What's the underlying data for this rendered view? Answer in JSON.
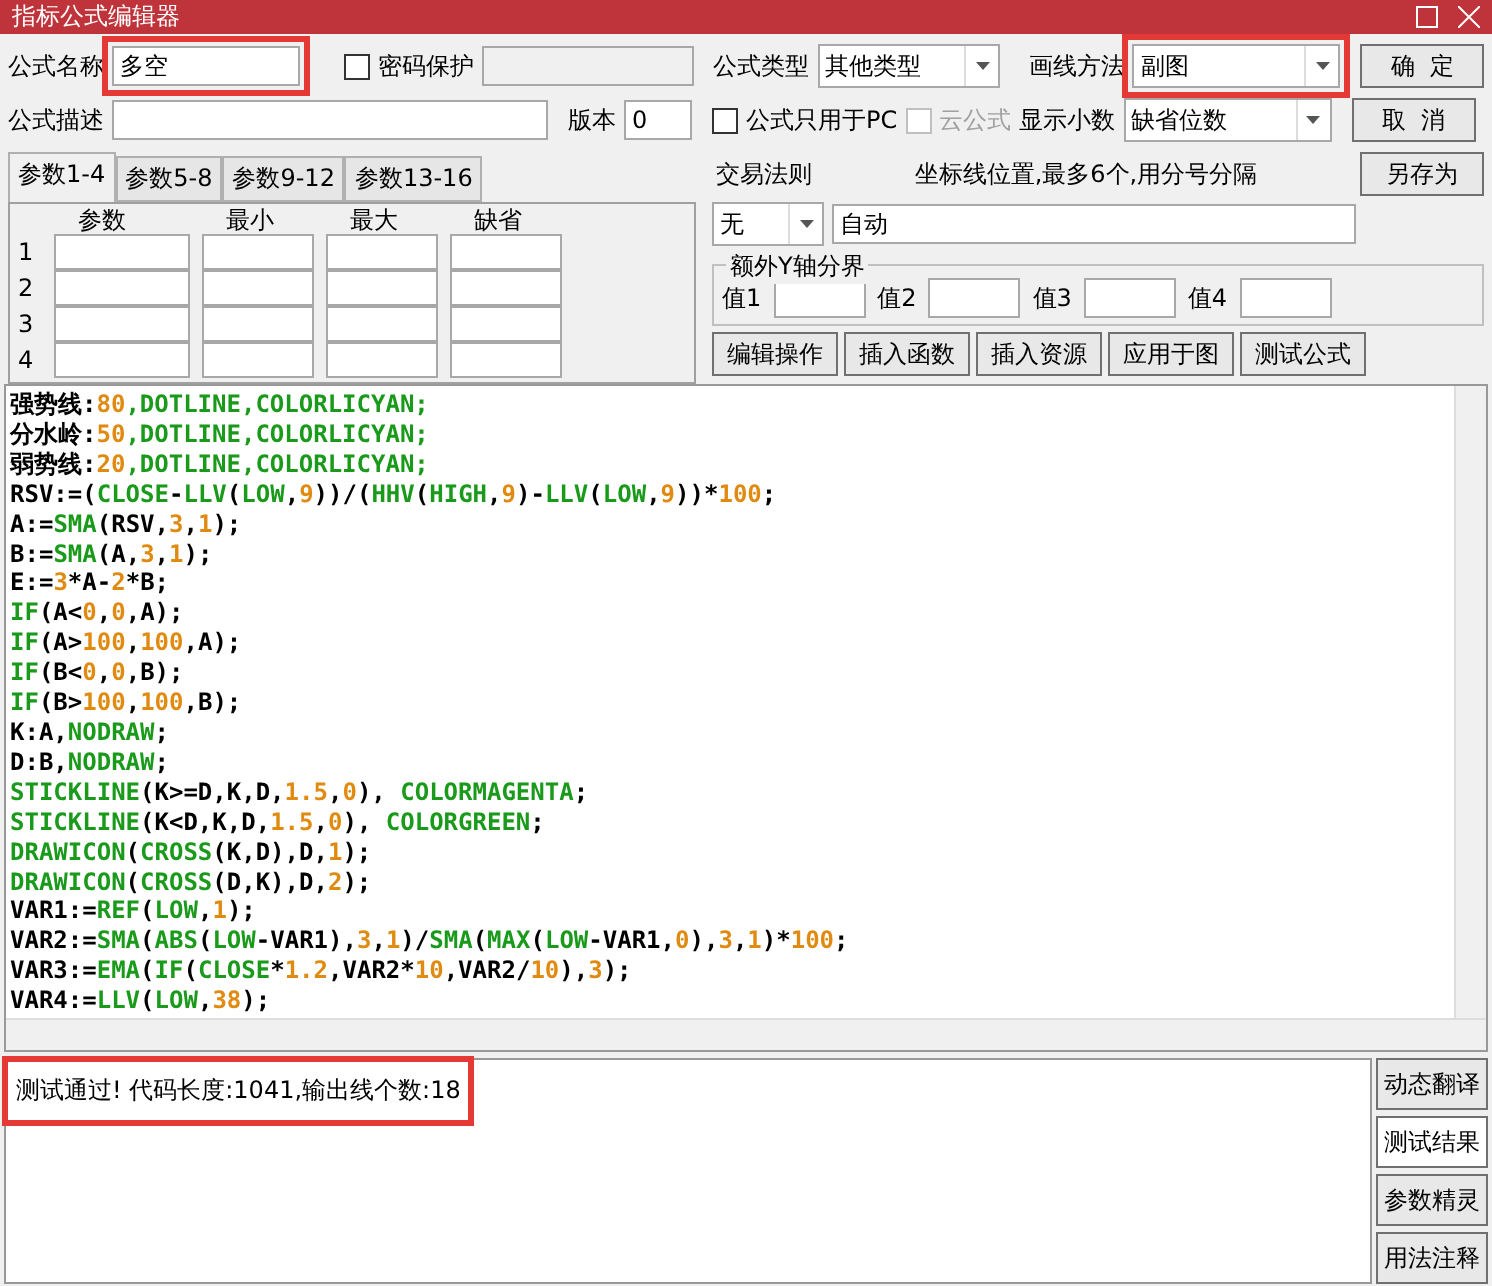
{
  "window": {
    "title": "指标公式编辑器"
  },
  "header": {
    "name_label": "公式名称",
    "name_value": "多空",
    "password": {
      "label": "密码保护",
      "checked": false
    },
    "type_label": "公式类型",
    "type_value": "其他类型",
    "draw_label": "画线方法",
    "draw_value": "副图",
    "desc_label": "公式描述",
    "version_label": "版本",
    "version_value": "0",
    "pc_only": {
      "label": "公式只用于PC",
      "checked": false
    },
    "cloud": {
      "label": "云公式",
      "checked": false,
      "disabled": true
    },
    "decimals_label": "显示小数",
    "decimals_value": "缺省位数"
  },
  "side_buttons": [
    "确  定",
    "取  消",
    "另存为"
  ],
  "param_tabs": [
    {
      "label": "参数1-4",
      "selected": true
    },
    {
      "label": "参数5-8",
      "selected": false
    },
    {
      "label": "参数9-12",
      "selected": false
    },
    {
      "label": "参数13-16",
      "selected": false
    }
  ],
  "param_columns": [
    "参数",
    "最小",
    "最大",
    "缺省"
  ],
  "param_rows": [
    "1",
    "2",
    "3",
    "4"
  ],
  "trade_rule": {
    "label": "交易法则",
    "value": "无"
  },
  "axis_lines": {
    "label": "坐标线位置,最多6个,用分号分隔",
    "value": "自动"
  },
  "y_split": {
    "title": "额外Y轴分界",
    "fields": [
      "值1",
      "值2",
      "值3",
      "值4"
    ]
  },
  "action_buttons": [
    "编辑操作",
    "插入函数",
    "插入资源",
    "应用于图",
    "测试公式"
  ],
  "code_lines": [
    [
      {
        "kind": "plain",
        "text": "强势线:"
      },
      {
        "kind": "number",
        "text": "80"
      },
      {
        "kind": "function",
        "text": ",DOTLINE,COLORLICYAN;"
      }
    ],
    [
      {
        "kind": "plain",
        "text": "分水岭:"
      },
      {
        "kind": "number",
        "text": "50"
      },
      {
        "kind": "function",
        "text": ",DOTLINE,COLORLICYAN;"
      }
    ],
    [
      {
        "kind": "plain",
        "text": "弱势线:"
      },
      {
        "kind": "number",
        "text": "20"
      },
      {
        "kind": "function",
        "text": ",DOTLINE,COLORLICYAN;"
      }
    ],
    [
      {
        "kind": "plain",
        "text": "RSV:=("
      },
      {
        "kind": "function",
        "text": "CLOSE"
      },
      {
        "kind": "plain",
        "text": "-"
      },
      {
        "kind": "function",
        "text": "LLV"
      },
      {
        "kind": "plain",
        "text": "("
      },
      {
        "kind": "function",
        "text": "LOW"
      },
      {
        "kind": "plain",
        "text": ","
      },
      {
        "kind": "number",
        "text": "9"
      },
      {
        "kind": "plain",
        "text": "))/("
      },
      {
        "kind": "function",
        "text": "HHV"
      },
      {
        "kind": "plain",
        "text": "("
      },
      {
        "kind": "function",
        "text": "HIGH"
      },
      {
        "kind": "plain",
        "text": ","
      },
      {
        "kind": "number",
        "text": "9"
      },
      {
        "kind": "plain",
        "text": ")-"
      },
      {
        "kind": "function",
        "text": "LLV"
      },
      {
        "kind": "plain",
        "text": "("
      },
      {
        "kind": "function",
        "text": "LOW"
      },
      {
        "kind": "plain",
        "text": ","
      },
      {
        "kind": "number",
        "text": "9"
      },
      {
        "kind": "plain",
        "text": "))*"
      },
      {
        "kind": "number",
        "text": "100"
      },
      {
        "kind": "plain",
        "text": ";"
      }
    ],
    [
      {
        "kind": "plain",
        "text": "A:="
      },
      {
        "kind": "function",
        "text": "SMA"
      },
      {
        "kind": "plain",
        "text": "(RSV,"
      },
      {
        "kind": "number",
        "text": "3"
      },
      {
        "kind": "plain",
        "text": ","
      },
      {
        "kind": "number",
        "text": "1"
      },
      {
        "kind": "plain",
        "text": ");"
      }
    ],
    [
      {
        "kind": "plain",
        "text": "B:="
      },
      {
        "kind": "function",
        "text": "SMA"
      },
      {
        "kind": "plain",
        "text": "(A,"
      },
      {
        "kind": "number",
        "text": "3"
      },
      {
        "kind": "plain",
        "text": ","
      },
      {
        "kind": "number",
        "text": "1"
      },
      {
        "kind": "plain",
        "text": ");"
      }
    ],
    [
      {
        "kind": "plain",
        "text": "E:="
      },
      {
        "kind": "number",
        "text": "3"
      },
      {
        "kind": "plain",
        "text": "*A-"
      },
      {
        "kind": "number",
        "text": "2"
      },
      {
        "kind": "plain",
        "text": "*B;"
      }
    ],
    [
      {
        "kind": "function",
        "text": "IF"
      },
      {
        "kind": "plain",
        "text": "(A<"
      },
      {
        "kind": "number",
        "text": "0"
      },
      {
        "kind": "plain",
        "text": ","
      },
      {
        "kind": "number",
        "text": "0"
      },
      {
        "kind": "plain",
        "text": ",A);"
      }
    ],
    [
      {
        "kind": "function",
        "text": "IF"
      },
      {
        "kind": "plain",
        "text": "(A>"
      },
      {
        "kind": "number",
        "text": "100"
      },
      {
        "kind": "plain",
        "text": ","
      },
      {
        "kind": "number",
        "text": "100"
      },
      {
        "kind": "plain",
        "text": ",A);"
      }
    ],
    [
      {
        "kind": "function",
        "text": "IF"
      },
      {
        "kind": "plain",
        "text": "(B<"
      },
      {
        "kind": "number",
        "text": "0"
      },
      {
        "kind": "plain",
        "text": ","
      },
      {
        "kind": "number",
        "text": "0"
      },
      {
        "kind": "plain",
        "text": ",B);"
      }
    ],
    [
      {
        "kind": "function",
        "text": "IF"
      },
      {
        "kind": "plain",
        "text": "(B>"
      },
      {
        "kind": "number",
        "text": "100"
      },
      {
        "kind": "plain",
        "text": ","
      },
      {
        "kind": "number",
        "text": "100"
      },
      {
        "kind": "plain",
        "text": ",B);"
      }
    ],
    [
      {
        "kind": "plain",
        "text": "K:A,"
      },
      {
        "kind": "function",
        "text": "NODRAW"
      },
      {
        "kind": "plain",
        "text": ";"
      }
    ],
    [
      {
        "kind": "plain",
        "text": "D:B,"
      },
      {
        "kind": "function",
        "text": "NODRAW"
      },
      {
        "kind": "plain",
        "text": ";"
      }
    ],
    [
      {
        "kind": "function",
        "text": "STICKLINE"
      },
      {
        "kind": "plain",
        "text": "(K>=D,K,D,"
      },
      {
        "kind": "number",
        "text": "1.5"
      },
      {
        "kind": "plain",
        "text": ","
      },
      {
        "kind": "number",
        "text": "0"
      },
      {
        "kind": "plain",
        "text": "), "
      },
      {
        "kind": "function",
        "text": "COLORMAGENTA"
      },
      {
        "kind": "plain",
        "text": ";"
      }
    ],
    [
      {
        "kind": "function",
        "text": "STICKLINE"
      },
      {
        "kind": "plain",
        "text": "(K<D,K,D,"
      },
      {
        "kind": "number",
        "text": "1.5"
      },
      {
        "kind": "plain",
        "text": ","
      },
      {
        "kind": "number",
        "text": "0"
      },
      {
        "kind": "plain",
        "text": "), "
      },
      {
        "kind": "function",
        "text": "COLORGREEN"
      },
      {
        "kind": "plain",
        "text": ";"
      }
    ],
    [
      {
        "kind": "function",
        "text": "DRAWICON"
      },
      {
        "kind": "plain",
        "text": "("
      },
      {
        "kind": "function",
        "text": "CROSS"
      },
      {
        "kind": "plain",
        "text": "(K,D),D,"
      },
      {
        "kind": "number",
        "text": "1"
      },
      {
        "kind": "plain",
        "text": ");"
      }
    ],
    [
      {
        "kind": "function",
        "text": "DRAWICON"
      },
      {
        "kind": "plain",
        "text": "("
      },
      {
        "kind": "function",
        "text": "CROSS"
      },
      {
        "kind": "plain",
        "text": "(D,K),D,"
      },
      {
        "kind": "number",
        "text": "2"
      },
      {
        "kind": "plain",
        "text": ");"
      }
    ],
    [
      {
        "kind": "plain",
        "text": "VAR1:="
      },
      {
        "kind": "function",
        "text": "REF"
      },
      {
        "kind": "plain",
        "text": "("
      },
      {
        "kind": "function",
        "text": "LOW"
      },
      {
        "kind": "plain",
        "text": ","
      },
      {
        "kind": "number",
        "text": "1"
      },
      {
        "kind": "plain",
        "text": ");"
      }
    ],
    [
      {
        "kind": "plain",
        "text": "VAR2:="
      },
      {
        "kind": "function",
        "text": "SMA"
      },
      {
        "kind": "plain",
        "text": "("
      },
      {
        "kind": "function",
        "text": "ABS"
      },
      {
        "kind": "plain",
        "text": "("
      },
      {
        "kind": "function",
        "text": "LOW"
      },
      {
        "kind": "plain",
        "text": "-VAR1),"
      },
      {
        "kind": "number",
        "text": "3"
      },
      {
        "kind": "plain",
        "text": ","
      },
      {
        "kind": "number",
        "text": "1"
      },
      {
        "kind": "plain",
        "text": ")/"
      },
      {
        "kind": "function",
        "text": "SMA"
      },
      {
        "kind": "plain",
        "text": "("
      },
      {
        "kind": "function",
        "text": "MAX"
      },
      {
        "kind": "plain",
        "text": "("
      },
      {
        "kind": "function",
        "text": "LOW"
      },
      {
        "kind": "plain",
        "text": "-VAR1,"
      },
      {
        "kind": "number",
        "text": "0"
      },
      {
        "kind": "plain",
        "text": "),"
      },
      {
        "kind": "number",
        "text": "3"
      },
      {
        "kind": "plain",
        "text": ","
      },
      {
        "kind": "number",
        "text": "1"
      },
      {
        "kind": "plain",
        "text": ")*"
      },
      {
        "kind": "number",
        "text": "100"
      },
      {
        "kind": "plain",
        "text": ";"
      }
    ],
    [
      {
        "kind": "plain",
        "text": "VAR3:="
      },
      {
        "kind": "function",
        "text": "EMA"
      },
      {
        "kind": "plain",
        "text": "("
      },
      {
        "kind": "function",
        "text": "IF"
      },
      {
        "kind": "plain",
        "text": "("
      },
      {
        "kind": "function",
        "text": "CLOSE"
      },
      {
        "kind": "plain",
        "text": "*"
      },
      {
        "kind": "number",
        "text": "1.2"
      },
      {
        "kind": "plain",
        "text": ",VAR2*"
      },
      {
        "kind": "number",
        "text": "10"
      },
      {
        "kind": "plain",
        "text": ",VAR2/"
      },
      {
        "kind": "number",
        "text": "10"
      },
      {
        "kind": "plain",
        "text": "),"
      },
      {
        "kind": "number",
        "text": "3"
      },
      {
        "kind": "plain",
        "text": ");"
      }
    ],
    [
      {
        "kind": "plain",
        "text": "VAR4:="
      },
      {
        "kind": "function",
        "text": "LLV"
      },
      {
        "kind": "plain",
        "text": "("
      },
      {
        "kind": "function",
        "text": "LOW"
      },
      {
        "kind": "plain",
        "text": ","
      },
      {
        "kind": "number",
        "text": "38"
      },
      {
        "kind": "plain",
        "text": ");"
      }
    ]
  ],
  "output": {
    "message": "测试通过! 代码长度:1041,输出线个数:18"
  },
  "output_tabs": [
    {
      "label": "动态翻译",
      "selected": false
    },
    {
      "label": "测试结果",
      "selected": true
    },
    {
      "label": "参数精灵",
      "selected": false
    },
    {
      "label": "用法注释",
      "selected": false
    }
  ],
  "highlights": {
    "name": true,
    "draw_method": true,
    "output": true
  }
}
